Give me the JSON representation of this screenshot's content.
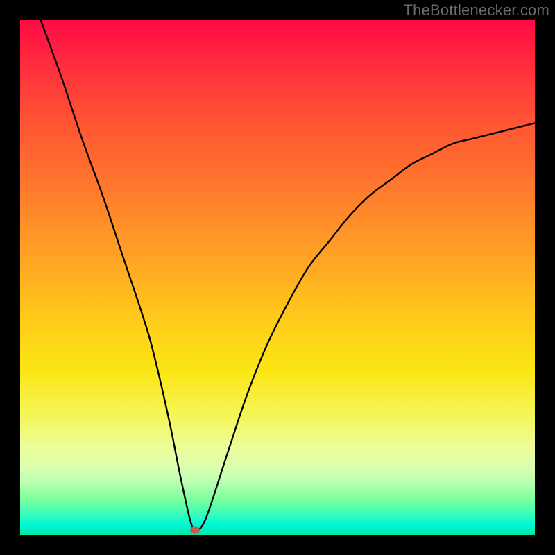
{
  "attribution": "TheBottlenecker.com",
  "chart_data": {
    "type": "line",
    "title": "",
    "xlabel": "",
    "ylabel": "",
    "xlim": [
      0,
      100
    ],
    "ylim": [
      0,
      100
    ],
    "series": [
      {
        "name": "bottleneck-curve",
        "x": [
          4,
          8,
          12,
          16,
          20,
          24,
          26,
          29,
          31,
          33,
          34,
          36,
          40,
          44,
          48,
          52,
          56,
          60,
          64,
          68,
          72,
          76,
          80,
          84,
          88,
          92,
          96,
          100
        ],
        "y": [
          100,
          89,
          77,
          66,
          54,
          42,
          35,
          22,
          12,
          3,
          1,
          3,
          15,
          27,
          37,
          45,
          52,
          57,
          62,
          66,
          69,
          72,
          74,
          76,
          77,
          78,
          79,
          80
        ]
      }
    ],
    "marker": {
      "x": 34,
      "y": 1
    },
    "gradient_note": "vertical rainbow (red top → green bottom)"
  }
}
